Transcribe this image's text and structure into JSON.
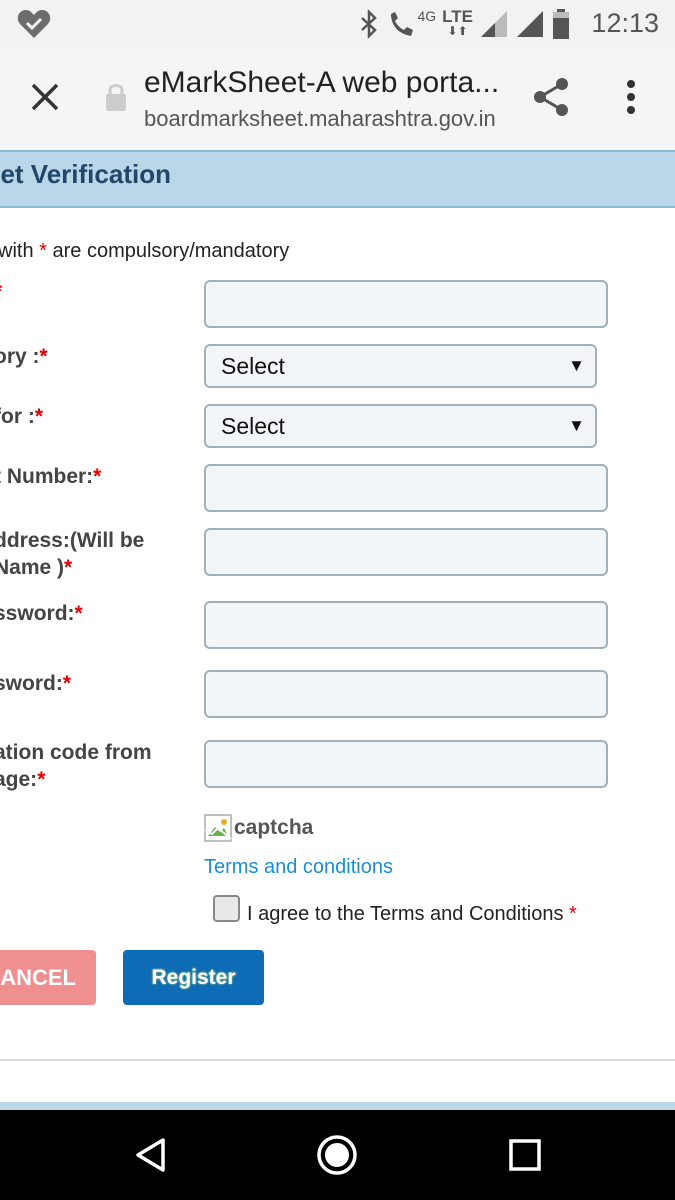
{
  "status_bar": {
    "time": "12:13",
    "network_label": "LTE",
    "network_type": "4G",
    "icons": [
      "heart-check-icon",
      "bluetooth-icon",
      "wifi-call-icon",
      "signal-icon",
      "battery-icon"
    ]
  },
  "browser": {
    "page_title": "eMarkSheet-A web porta...",
    "url": "boardmarksheet.maharashtra.gov.in"
  },
  "page": {
    "banner_title": "eet Verification",
    "mandatory_note_prefix": "with",
    "mandatory_note_star": "*",
    "mandatory_note_suffix": "are compulsory/mandatory",
    "fields": [
      {
        "label": "",
        "required": "*"
      },
      {
        "label": "ory :",
        "required": "*"
      },
      {
        "label": "for :",
        "required": "*"
      },
      {
        "label": "t Number:",
        "required": "*"
      },
      {
        "label_line1": "ddress:(Will be",
        "label_line2": " Name )",
        "required": "*"
      },
      {
        "label": "ssword:",
        "required": "*"
      },
      {
        "label": "sword:",
        "required": "*"
      },
      {
        "label_line1": "ation code from",
        "label_line2": "age:",
        "required": "*"
      }
    ],
    "select_value_1": "Select",
    "select_value_2": "Select",
    "captcha_alt": "captcha",
    "terms_link": "Terms and conditions",
    "agree_text": "I agree to the Terms and Conditions",
    "agree_required": "*",
    "cancel_label": "CANCEL",
    "register_label": "Register"
  },
  "colors": {
    "banner": "#b9d7e8",
    "banner_text": "#23476b",
    "required": "#e00000",
    "link": "#1a8fd0",
    "register": "#0e6bb5",
    "cancel": "#ef8f8f"
  }
}
